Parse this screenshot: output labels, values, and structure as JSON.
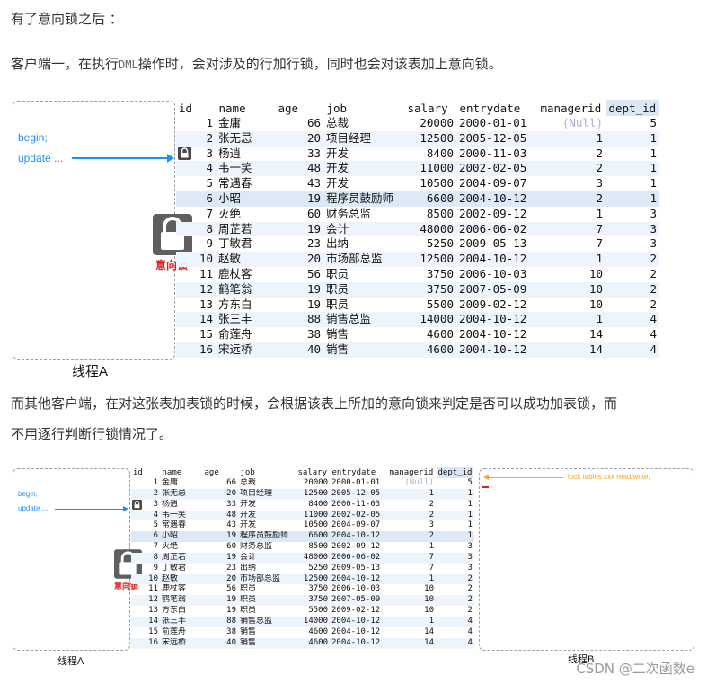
{
  "heading": "有了意向锁之后 ：",
  "para1": {
    "before": "客户端一，在执行",
    "code": "DML",
    "after": "操作时，会对涉及的行加行锁，同时也会对该表加上意向锁。"
  },
  "para2_line1": "而其他客户端，在对这张表加表锁的时候，会根据该表上所加的意向锁来判定是否可以成功加表锁，而",
  "para2_line2": "不用逐行判断行锁情况了。",
  "figure1": {
    "code": [
      "begin;",
      "update ..."
    ],
    "lock_label": "意向锁",
    "thread_label": "线程A",
    "lock_icon": "padlock-icon",
    "row_lock_icon": "small-padlock-icon"
  },
  "figure2": {
    "code": [
      "begin;",
      "update ..."
    ],
    "lock_label": "意向锁",
    "thread_a_label": "线程A",
    "thread_b_label": "线程B",
    "thread_b_code": "lock tables xxx read/write;",
    "colors": {
      "thread_b_arrow": "#f5a623",
      "thread_b_mark": "#e02020"
    }
  },
  "table": {
    "columns": [
      "id",
      "name",
      "age",
      "job",
      "salary",
      "entrydate",
      "managerid",
      "dept_id"
    ],
    "rows": [
      [
        "1",
        "金庸",
        "66",
        "总裁",
        "20000",
        "2000-01-01",
        "(Null)",
        "5"
      ],
      [
        "2",
        "张无忌",
        "20",
        "项目经理",
        "12500",
        "2005-12-05",
        "1",
        "1"
      ],
      [
        "3",
        "杨逍",
        "33",
        "开发",
        "8400",
        "2000-11-03",
        "2",
        "1"
      ],
      [
        "4",
        "韦一笑",
        "48",
        "开发",
        "11000",
        "2002-02-05",
        "2",
        "1"
      ],
      [
        "5",
        "常遇春",
        "43",
        "开发",
        "10500",
        "2004-09-07",
        "3",
        "1"
      ],
      [
        "6",
        "小昭",
        "19",
        "程序员鼓励师",
        "6600",
        "2004-10-12",
        "2",
        "1"
      ],
      [
        "7",
        "灭绝",
        "60",
        "财务总监",
        "8500",
        "2002-09-12",
        "1",
        "3"
      ],
      [
        "8",
        "周芷若",
        "19",
        "会计",
        "48000",
        "2006-06-02",
        "7",
        "3"
      ],
      [
        "9",
        "丁敏君",
        "23",
        "出纳",
        "5250",
        "2009-05-13",
        "7",
        "3"
      ],
      [
        "10",
        "赵敏",
        "20",
        "市场部总监",
        "12500",
        "2004-10-12",
        "1",
        "2"
      ],
      [
        "11",
        "鹿杖客",
        "56",
        "职员",
        "3750",
        "2006-10-03",
        "10",
        "2"
      ],
      [
        "12",
        "鹤笔翁",
        "19",
        "职员",
        "3750",
        "2007-05-09",
        "10",
        "2"
      ],
      [
        "13",
        "方东白",
        "19",
        "职员",
        "5500",
        "2009-02-12",
        "10",
        "2"
      ],
      [
        "14",
        "张三丰",
        "88",
        "销售总监",
        "14000",
        "2004-10-12",
        "1",
        "4"
      ],
      [
        "15",
        "俞莲舟",
        "38",
        "销售",
        "4600",
        "2004-10-12",
        "14",
        "4"
      ],
      [
        "16",
        "宋远桥",
        "40",
        "销售",
        "4600",
        "2004-10-12",
        "14",
        "4"
      ]
    ]
  },
  "watermark": "CSDN @二次函数e"
}
